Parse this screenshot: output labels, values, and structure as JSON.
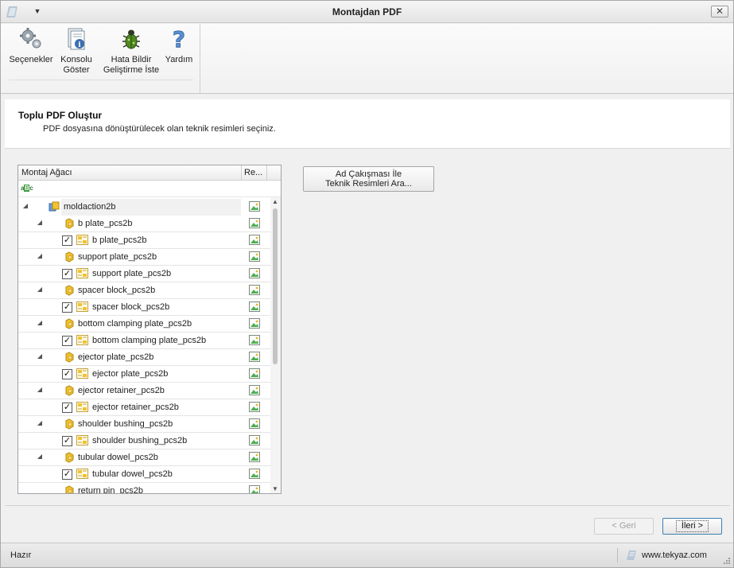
{
  "window": {
    "title": "Montajdan PDF",
    "close_label": "✕"
  },
  "ribbon": {
    "buttons": [
      {
        "label": "Seçenekler",
        "icon": "gears-icon"
      },
      {
        "label": "Konsolu\nGöster",
        "icon": "console-info-icon"
      },
      {
        "label": "Hata Bildir\nGeliştirme İste",
        "icon": "bug-icon"
      },
      {
        "label": "Yardım",
        "icon": "help-question-icon"
      }
    ]
  },
  "header": {
    "title": "Toplu PDF Oluştur",
    "subtitle": "PDF dosyasına dönüştürülecek olan teknik resimleri seçiniz."
  },
  "tree": {
    "columns": {
      "name": "Montaj Ağacı",
      "resource": "Re..."
    },
    "filter_icon_text": [
      "a",
      "B",
      "c"
    ],
    "root": {
      "label": "moldaction2b",
      "expanded": true
    },
    "items": [
      {
        "assembly": "b plate_pcs2b",
        "drawing": "b plate_pcs2b",
        "checked": true
      },
      {
        "assembly": "support plate_pcs2b",
        "drawing": "support plate_pcs2b",
        "checked": true
      },
      {
        "assembly": "spacer block_pcs2b",
        "drawing": "spacer block_pcs2b",
        "checked": true
      },
      {
        "assembly": "bottom clamping plate_pcs2b",
        "drawing": "bottom clamping plate_pcs2b",
        "checked": true
      },
      {
        "assembly": "ejector plate_pcs2b",
        "drawing": "ejector plate_pcs2b",
        "checked": true
      },
      {
        "assembly": "ejector retainer_pcs2b",
        "drawing": "ejector retainer_pcs2b",
        "checked": true
      },
      {
        "assembly": "shoulder bushing_pcs2b",
        "drawing": "shoulder bushing_pcs2b",
        "checked": true
      },
      {
        "assembly": "tubular dowel_pcs2b",
        "drawing": "tubular dowel_pcs2b",
        "checked": true
      }
    ],
    "partial_item": "return pin_pcs2b"
  },
  "actions": {
    "search_button": "Ad Çakışması İle\nTeknik Resimleri Ara...",
    "back_button": "< Geri",
    "next_button": "İleri >"
  },
  "status": {
    "text": "Hazır",
    "site": "www.tekyaz.com"
  },
  "colors": {
    "accent": "#3c7fb1",
    "asm_yellow": "#f2c230",
    "res_green": "#4caf50"
  }
}
